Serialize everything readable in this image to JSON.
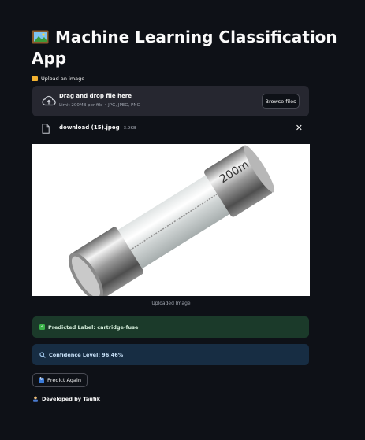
{
  "page": {
    "title": "Machine Learning Classification App",
    "title_icon": "framed-picture-icon"
  },
  "uploader": {
    "label": "Upload an image",
    "label_icon": "folder-icon",
    "dropzone_title": "Drag and drop file here",
    "dropzone_subtitle": "Limit 200MB per file • JPG, JPEG, PNG",
    "browse_label": "Browse files",
    "file_name": "download (15).jpeg",
    "file_size": "3.9KB"
  },
  "image": {
    "caption": "Uploaded Image",
    "subject": "cartridge fuse",
    "fuse_marking": "200m"
  },
  "results": {
    "predicted_label": "Predicted Label: cartridge-fuse",
    "confidence": "Confidence Level: 96.46%"
  },
  "actions": {
    "predict_again_label": "Predict Again"
  },
  "footer": {
    "text": "Developed by Taufik"
  },
  "colors": {
    "background": "#0e1117",
    "dropzone": "#262730",
    "success_bg": "#1b3a2a",
    "info_bg": "#172d43"
  }
}
